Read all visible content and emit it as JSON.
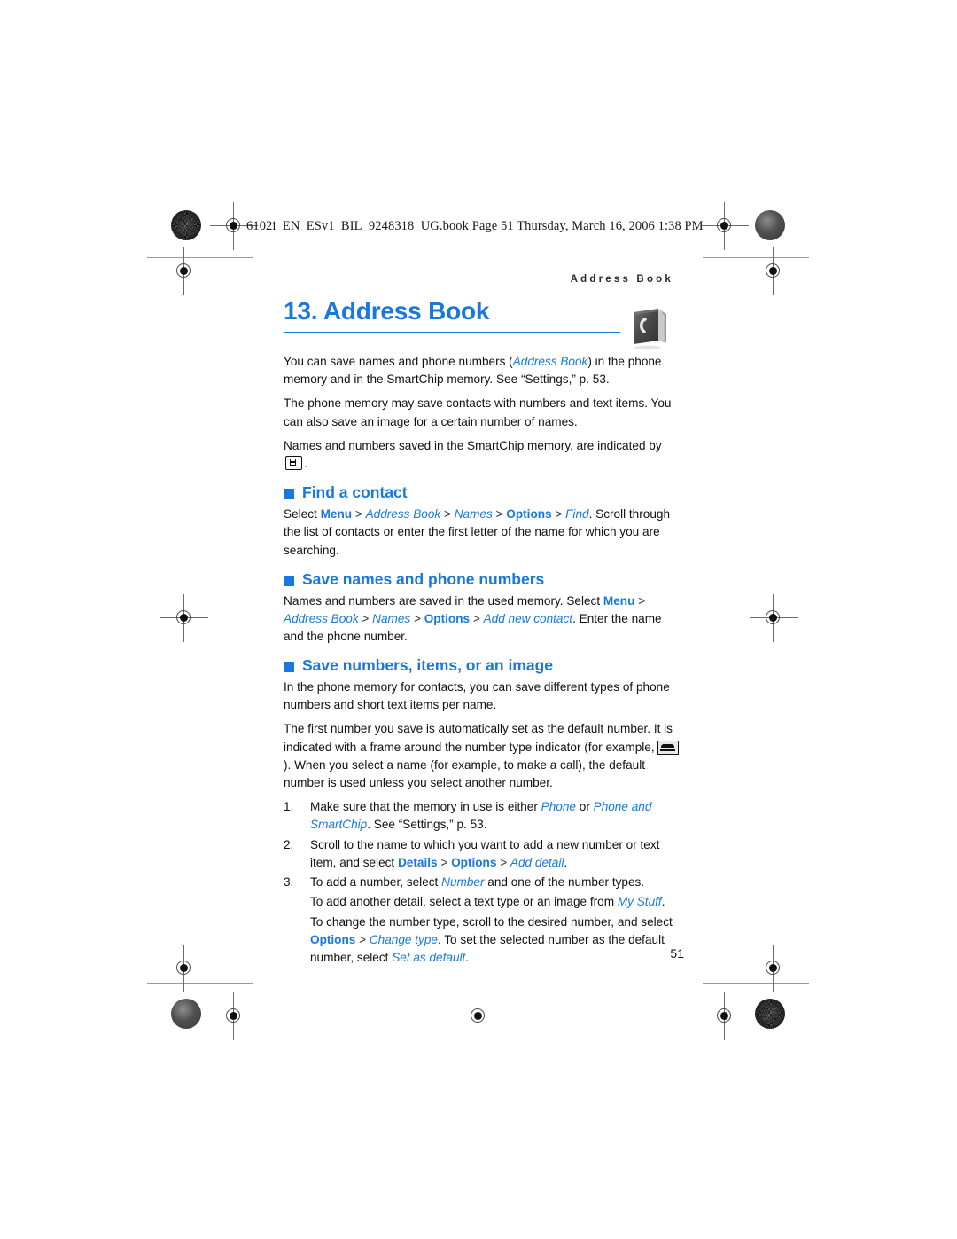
{
  "document": {
    "file_header": "6102i_EN_ESv1_BIL_9248318_UG.book   Page 51   Thursday, March 16, 2006   1:38 PM",
    "running_head": "Address Book",
    "page_number": "51"
  },
  "chapter": {
    "title": "13. Address Book",
    "icon": "address-book-icon"
  },
  "intro": {
    "p1_a": "You can save names and phone numbers (",
    "p1_em": "Address Book",
    "p1_b": ") in the phone memory and in the SmartChip memory. See “Settings,” p. 53.",
    "p2": "The phone memory may save contacts with numbers and text items. You can also save an image for a certain number of names.",
    "p3_a": "Names and numbers saved in the SmartChip memory, are indicated by",
    "p3_b": "."
  },
  "sections": [
    {
      "heading": "Find a contact",
      "bullet": "square-bullet-icon",
      "body": {
        "lead": "Select ",
        "menu": "Menu",
        "gt1": " > ",
        "address_book": "Address Book",
        "gt2": " > ",
        "names": "Names",
        "gt3": " > ",
        "options": "Options",
        "gt4": " > ",
        "find": "Find",
        "tail": ". Scroll through the list of contacts or enter the first letter of the name for which you are searching."
      }
    },
    {
      "heading": "Save names and phone numbers",
      "bullet": "square-bullet-icon",
      "body": {
        "lead": "Names and numbers are saved in the used memory. Select ",
        "menu": "Menu",
        "gt1": " > ",
        "address_book": "Address Book",
        "gt2": " > ",
        "names": "Names",
        "gt3": " > ",
        "options": "Options",
        "gt4": " > ",
        "add_new_contact": "Add new contact",
        "tail": ". Enter the name and the phone number."
      }
    },
    {
      "heading": "Save numbers, items, or an image",
      "bullet": "square-bullet-icon",
      "body": {
        "p1": "In the phone memory for contacts, you can save different types of phone numbers and short text items per name.",
        "p2_a": "The first number you save is automatically set as the default number. It is indicated with a frame around the number type indicator (for example,",
        "p2_b": "). When you select a name (for example, to make a call), the default number is used unless you select another number."
      }
    }
  ],
  "steps": [
    {
      "num": "1.",
      "a": "Make sure that the memory in use is either ",
      "em1": "Phone",
      "b": " or ",
      "em2": "Phone and SmartChip",
      "c": ". See “Settings,” p. 53."
    },
    {
      "num": "2.",
      "a": "Scroll to the name to which you want to add a new number or text item, and select ",
      "em1": "Details",
      "b": " > ",
      "em2": "Options",
      "c": " > ",
      "em3": "Add detail",
      "d": "."
    },
    {
      "num": "3.",
      "a": "To add a number, select ",
      "em1": "Number",
      "b": " and one of the number types.",
      "p2_a": "To add another detail, select a text type or an image from ",
      "p2_em": "My Stuff",
      "p2_b": ".",
      "p3_a": "To change the number type, scroll to the desired number, and select ",
      "p3_em1": "Options",
      "p3_b": " > ",
      "p3_em2": "Change type",
      "p3_c": ". To set the selected number as the default number, select ",
      "p3_em3": "Set as default",
      "p3_d": "."
    }
  ],
  "colors": {
    "accent_blue": "#1878e0",
    "text": "#111111"
  }
}
